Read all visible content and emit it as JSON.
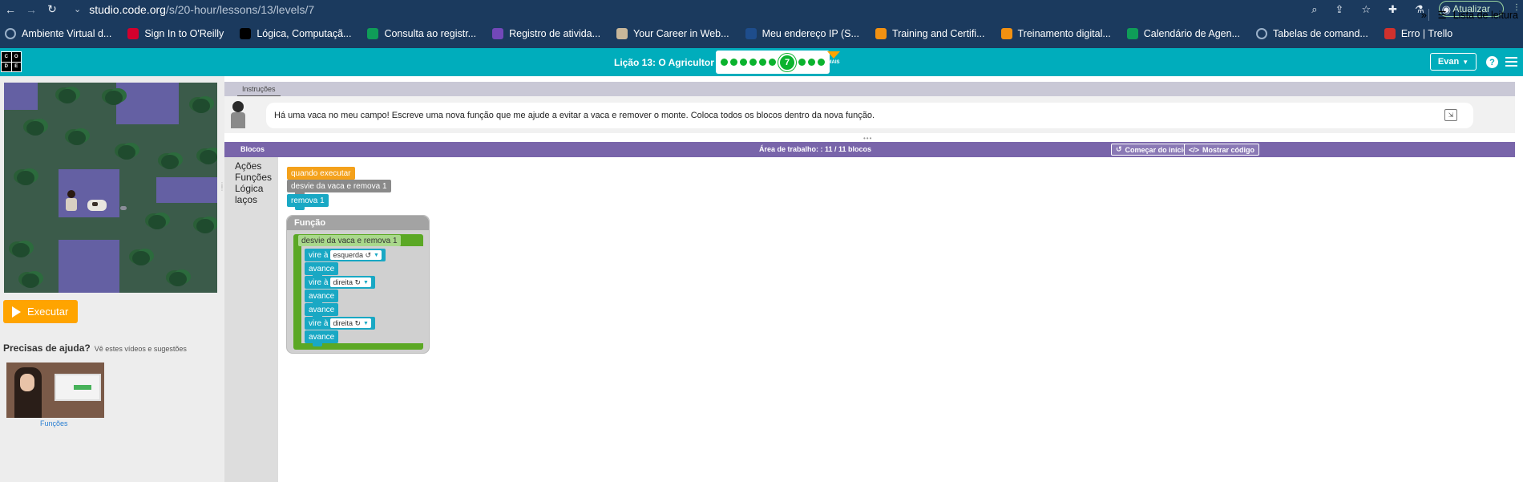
{
  "browser": {
    "url_host": "studio.code.org",
    "url_path": "/s/20-hour/lessons/13/levels/7",
    "update_label": "Atualizar"
  },
  "bookmarks": [
    {
      "label": "Ambiente Virtual d...",
      "icon": "globe-icon",
      "color": "#ffffff"
    },
    {
      "label": "Sign In to O'Reilly",
      "icon": "oreilly-icon",
      "color": "#d3002d"
    },
    {
      "label": "Lógica, Computaçã...",
      "icon": "notion-icon",
      "color": "#000000"
    },
    {
      "label": "Consulta ao registr...",
      "icon": "sheets-icon",
      "color": "#0f9d58"
    },
    {
      "label": "Registro de ativida...",
      "icon": "forms-icon",
      "color": "#7248b9"
    },
    {
      "label": "Your Career in Web...",
      "icon": "deer-icon",
      "color": "#c8b79a"
    },
    {
      "label": "Meu endereço IP (S...",
      "icon": "ip-icon",
      "color": "#1e4d8c"
    },
    {
      "label": "Training and Certifi...",
      "icon": "aws-cube-icon",
      "color": "#f29111"
    },
    {
      "label": "Treinamento digital...",
      "icon": "aws-cube-icon",
      "color": "#f29111"
    },
    {
      "label": "Calendário de Agen...",
      "icon": "sheets-icon",
      "color": "#0f9d58"
    },
    {
      "label": "Tabelas de comand...",
      "icon": "wordpress-icon",
      "color": "#ffffff"
    },
    {
      "label": "Erro | Trello",
      "icon": "trello-icon",
      "color": "#d0312d"
    }
  ],
  "bookmarks_more": "»",
  "reading_list": "Lista de leitura",
  "cdo": {
    "logo_letters": [
      "C",
      "O",
      "D",
      "E"
    ],
    "lesson_title": "Lição 13: O Agricultor 2",
    "progress_before": 6,
    "current_level": "7",
    "progress_after": 3,
    "more_label": "MAIS",
    "user": "Evan",
    "help": "?"
  },
  "left": {
    "run_label": "Executar",
    "help_title": "Precisas de ajuda?",
    "help_sub": "Vê estes vídeos e sugestões",
    "video_label": "Funções"
  },
  "instructions": {
    "tab": "Instruções",
    "text": "Há uma vaca no meu campo! Escreve uma nova função que me ajude a evitar a vaca e remover o monte. Coloca todos os blocos dentro da nova função."
  },
  "workspace": {
    "toolbox_title": "Blocos",
    "title": "Área de trabalho: : 11 / 11 blocos",
    "start_over": "Começar do início",
    "show_code": "Mostrar código",
    "categories": [
      "Ações",
      "Funções",
      "Lógica",
      "laços"
    ]
  },
  "blocks": {
    "when_run": "quando executar",
    "call_func": "desvie da vaca e remova 1",
    "remove": "remova 1",
    "func_header": "Função",
    "func_name": "desvie da vaca e remova 1",
    "turn": "vire à",
    "left": "esquerda ↺",
    "right": "direita ↻",
    "forward": "avance"
  },
  "colors": {
    "header": "#00adbc",
    "workspace_bar": "#7965aa",
    "run_button": "#ffa400",
    "progress_green": "#0bb32e",
    "block_orange": "#f4a11b",
    "block_teal": "#19a8c4",
    "block_green": "#5ba825"
  }
}
